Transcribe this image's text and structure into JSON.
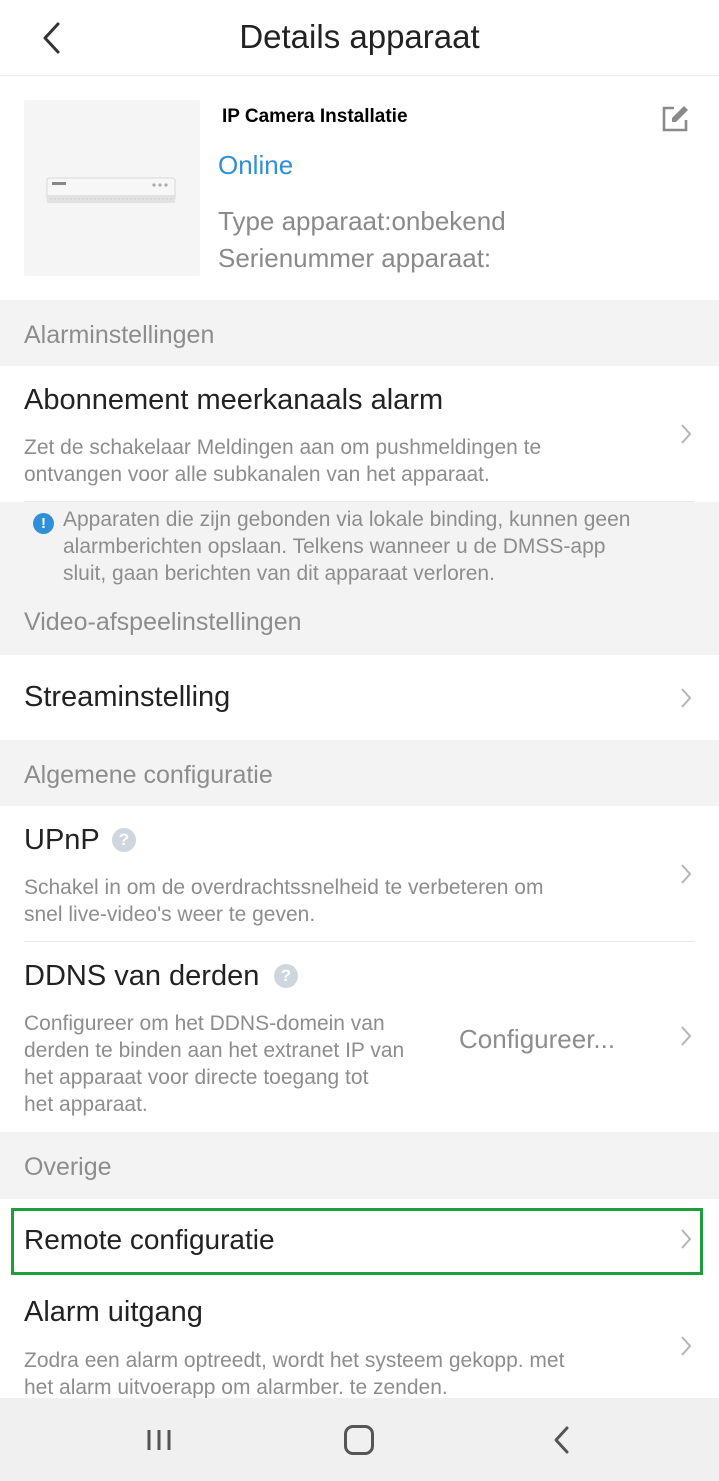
{
  "header": {
    "title": "Details apparaat"
  },
  "device": {
    "name": "IP Camera Installatie",
    "status": "Online",
    "type_line": "Type apparaat:onbekend",
    "serial_line": "Serienummer apparaat:",
    "status_color": "#2f8fd8"
  },
  "alarm_section": {
    "label": "Alarminstellingen",
    "subscription": {
      "title": "Abonnement meerkanaals alarm",
      "desc_line1": "Zet de schakelaar Meldingen aan om pushmeldingen te",
      "desc_line2": "ontvangen voor alle subkanalen van het apparaat."
    },
    "notice": {
      "line1": "Apparaten die zijn gebonden via lokale binding, kunnen geen",
      "line2": "alarmberichten opslaan. Telkens wanneer u de DMSS-app",
      "line3": "sluit, gaan berichten van dit apparaat verloren."
    }
  },
  "video_section": {
    "label": "Video-afspeelinstellingen",
    "stream": {
      "title": "Streaminstelling"
    }
  },
  "general_section": {
    "label": "Algemene configuratie",
    "upnp": {
      "title": "UPnP",
      "desc_line1": "Schakel in om de overdrachtssnelheid te verbeteren om",
      "desc_line2": "snel live-video's weer te geven."
    },
    "ddns": {
      "title": "DDNS van derden",
      "desc_line1": "Configureer om het DDNS-domein van",
      "desc_line2": "derden te binden aan het extranet IP van",
      "desc_line3": "het apparaat voor directe toegang tot",
      "desc_line4": "het apparaat.",
      "value": "Configureer..."
    }
  },
  "other_section": {
    "label": "Overige",
    "remote": {
      "title": "Remote configuratie"
    },
    "alarm_out": {
      "title": "Alarm uitgang",
      "desc_line1": "Zodra een alarm optreedt, wordt het systeem gekopp. met",
      "desc_line2": "het alarm uitvoerapp om alarmber. te zenden."
    }
  },
  "highlight_color": "#1d9e3c"
}
